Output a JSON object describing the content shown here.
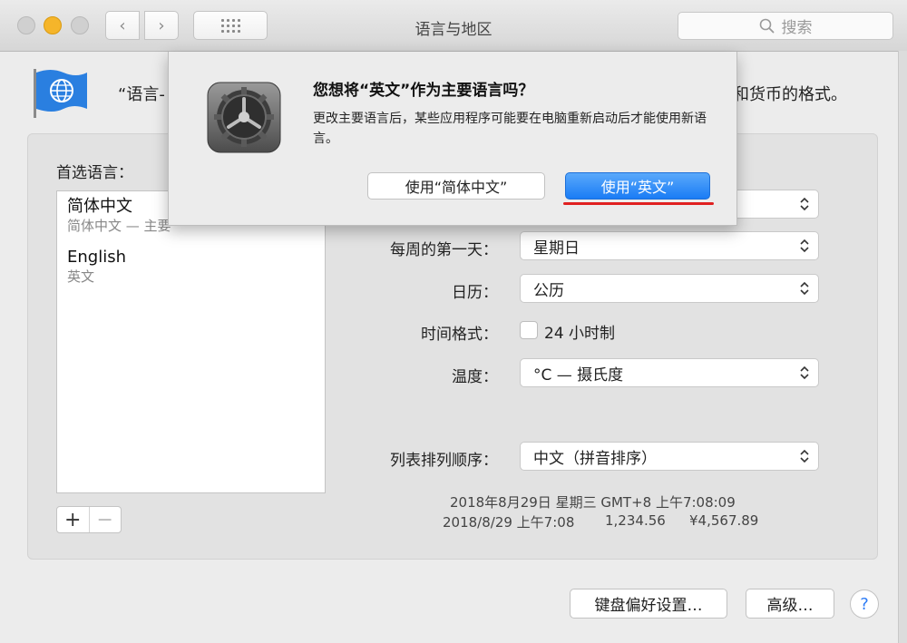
{
  "window": {
    "title": "语言与地区"
  },
  "toolbar": {
    "search_placeholder": "搜索"
  },
  "intro": {
    "lead": "“语言-",
    "tail": "和货币的格式。"
  },
  "preferred": {
    "label": "首选语言：",
    "languages": [
      {
        "name": "简体中文",
        "sub": "简体中文 — 主要"
      },
      {
        "name": "English",
        "sub": "英文"
      }
    ],
    "add": "+",
    "remove": "−"
  },
  "settings": {
    "week_label": "每周的第一天：",
    "week_value": "星期日",
    "calendar_label": "日历：",
    "calendar_value": "公历",
    "time_label": "时间格式：",
    "time_check_label": "24 小时制",
    "temp_label": "温度：",
    "temp_value": "°C — 摄氏度",
    "sort_label": "列表排列顺序：",
    "sort_value": "中文（拼音排序）"
  },
  "formats": {
    "line1": "2018年8月29日 星期三 GMT+8 上午7:08:09",
    "line2_date": "2018/8/29 上午7:08",
    "line2_num": "1,234.56",
    "line2_cur": "¥4,567.89"
  },
  "bottom": {
    "keyboard": "键盘偏好设置…",
    "advanced": "高级…",
    "help": "?"
  },
  "dialog": {
    "title": "您想将“英文”作为主要语言吗？",
    "body": "更改主要语言后，某些应用程序可能要在电脑重新启动后才能使用新语言。",
    "secondary": "使用“简体中文”",
    "primary": "使用“英文”"
  },
  "colors": {
    "accent": "#1a7cf5",
    "highlight": "#e02020",
    "warning_dot": "#f5b52a"
  }
}
